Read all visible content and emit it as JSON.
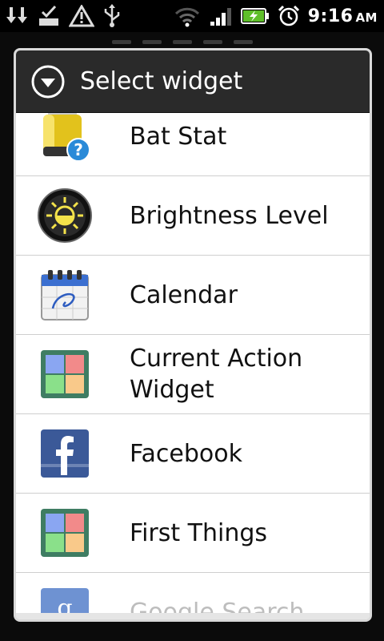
{
  "statusbar": {
    "icons_left": [
      "download-icon",
      "task-check-icon",
      "warning-icon",
      "usb-icon"
    ],
    "icons_right": [
      "wifi-icon",
      "signal-icon",
      "battery-charging-icon",
      "alarm-icon"
    ],
    "time": "9:16",
    "ampm": "AM"
  },
  "dialog": {
    "title": "Select widget",
    "items": [
      {
        "label": "Bat Stat",
        "icon": "battery-question-icon"
      },
      {
        "label": "Brightness Level",
        "icon": "brightness-icon"
      },
      {
        "label": "Calendar",
        "icon": "calendar-icon"
      },
      {
        "label": "Current Action Widget",
        "icon": "tiles-icon"
      },
      {
        "label": "Facebook",
        "icon": "facebook-icon"
      },
      {
        "label": "First Things",
        "icon": "tiles-icon"
      },
      {
        "label": "Google Search",
        "icon": "google-search-icon"
      }
    ]
  },
  "colors": {
    "header_bg": "#2a2a2a",
    "list_bg": "#ffffff",
    "divider": "#cfcfcf",
    "status_bg": "#000000"
  }
}
